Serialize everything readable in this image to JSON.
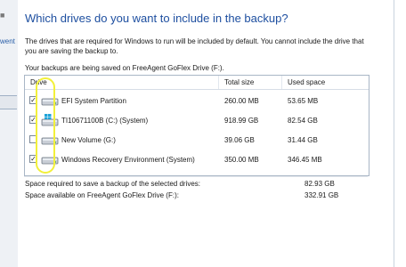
{
  "page": {
    "heading": "Which drives do you want to include in the backup?",
    "description": "The drives that are required for Windows to run will be included by default. You cannot include the drive that you are saving the backup to.",
    "saved_to": "Your backups are being saved on FreeAgent GoFlex Drive (F:)."
  },
  "left_strip": {
    "fragment_1": "■",
    "fragment_2": "went"
  },
  "table": {
    "headers": {
      "drive": "Drive",
      "total": "Total size",
      "used": "Used space"
    },
    "rows": [
      {
        "name": "EFI System Partition",
        "total": "260.00 MB",
        "used": "53.65 MB",
        "checked": true,
        "icon": "drive-icon"
      },
      {
        "name": "TI10671100B (C:) (System)",
        "total": "918.99 GB",
        "used": "82.54 GB",
        "checked": true,
        "icon": "windows-drive-icon"
      },
      {
        "name": "New Volume (G:)",
        "total": "39.06 GB",
        "used": "31.44 GB",
        "checked": false,
        "icon": "drive-icon"
      },
      {
        "name": "Windows Recovery Environment (System)",
        "total": "350.00 MB",
        "used": "346.45 MB",
        "checked": true,
        "icon": "drive-icon"
      }
    ]
  },
  "summary": {
    "required_label": "Space required to save a backup of the selected drives:",
    "required_value": "82.93 GB",
    "available_label": "Space available on FreeAgent GoFlex Drive (F:):",
    "available_value": "332.91 GB"
  },
  "colors": {
    "heading": "#1e4fa0",
    "annotation": "#f2f03a"
  }
}
